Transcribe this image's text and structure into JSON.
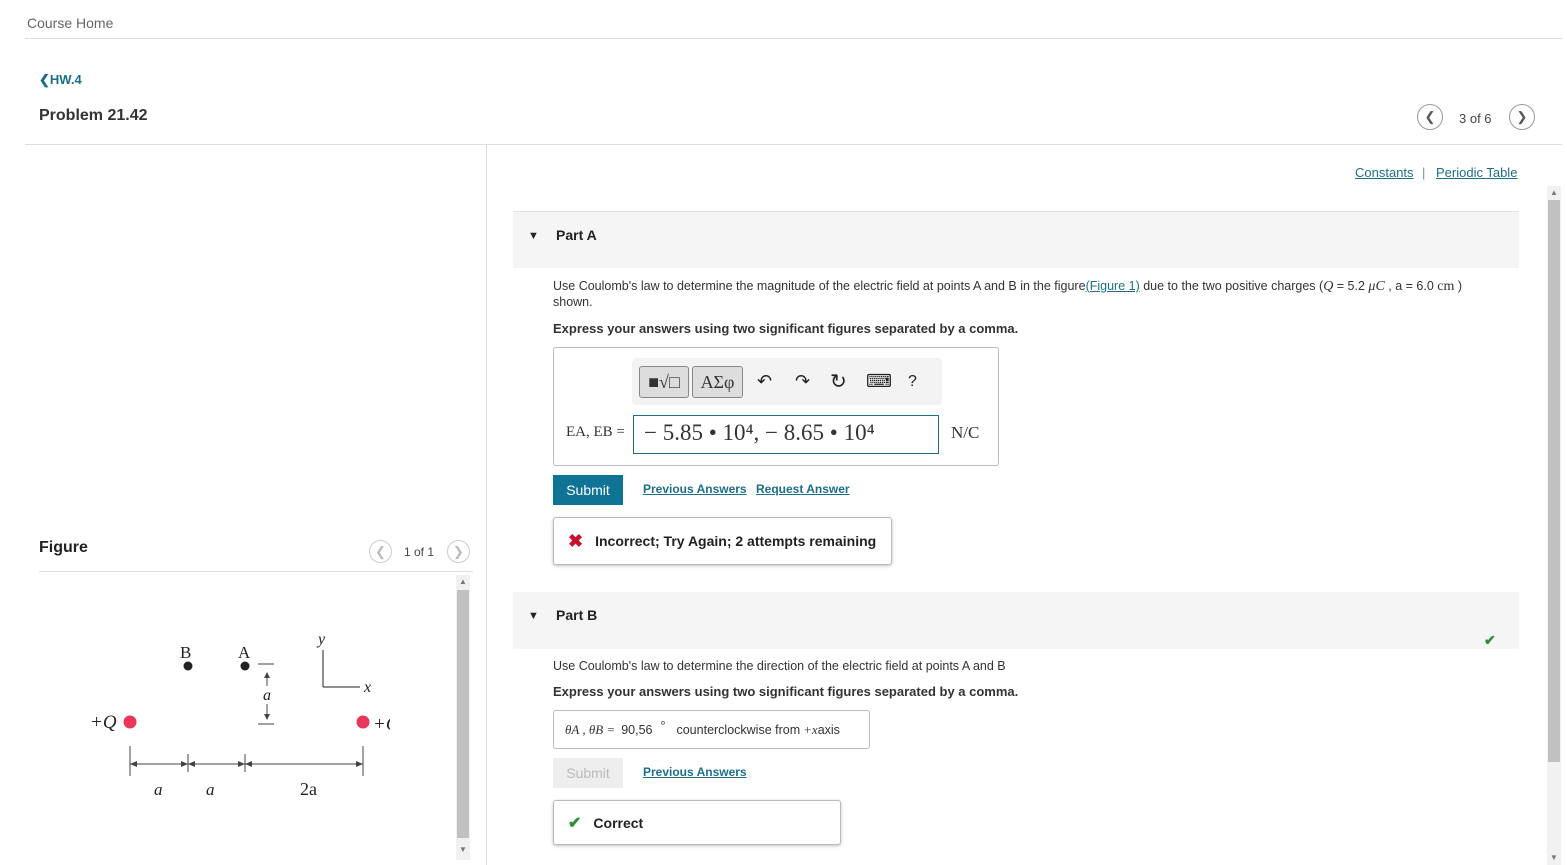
{
  "nav": {
    "course_home": "Course Home",
    "back_link": "HW.4",
    "problem_title": "Problem 21.42",
    "pager": "3 of 6"
  },
  "links": {
    "constants": "Constants",
    "separator": "|",
    "periodic_table": "Periodic Table"
  },
  "partA": {
    "label": "Part A",
    "question_pre": "Use Coulomb's law to determine the magnitude of the electric field at points A and B in the figure",
    "figure_link": "(Figure 1)",
    "question_post": " due to the two positive charges (",
    "q_sym": "Q",
    "q_val": " = 5.2 ",
    "q_unit": "μC",
    "a_text": " , a = 6.0 ",
    "a_unit": "cm",
    "close": " )",
    "question_line2": "shown.",
    "instruction": "Express your answers using two significant figures separated by a comma.",
    "toolbar": {
      "template_label": "■√□",
      "greek_label": "ΑΣφ",
      "undo": "↶",
      "redo": "↷",
      "reset": "↻",
      "keyboard": "⌨",
      "help": "?"
    },
    "answer_label": "EA, EB =",
    "answer_value": "− 5.85 • 10⁴, − 8.65 • 10⁴",
    "unit": "N/C",
    "submit": "Submit",
    "previous_answers": "Previous Answers",
    "request_answer": "Request Answer",
    "feedback": "Incorrect; Try Again; 2 attempts remaining",
    "feedback_icon": "✖"
  },
  "partB": {
    "label": "Part B",
    "check_icon": "✔",
    "question": "Use Coulomb's law to determine the direction of the electric field at points A and B",
    "instruction": "Express your answers using two significant figures separated by a comma.",
    "answer_label": "θA , θB =",
    "answer_value": "90,56",
    "degree": "°",
    "direction_pre": "counterclockwise from ",
    "direction_axis": "+x",
    "direction_post": " axis",
    "submit": "Submit",
    "previous_answers": "Previous Answers",
    "feedback": "Correct",
    "feedback_icon": "✔"
  },
  "figure": {
    "title": "Figure",
    "pager": "1 of 1",
    "labels": {
      "B": "B",
      "A": "A",
      "y": "y",
      "x": "x",
      "a_vertical": "a",
      "plusQ_left": "+Q",
      "plusQ_right": "+Q",
      "dim_a1": "a",
      "dim_a2": "a",
      "dim_2a": "2a"
    },
    "colors": {
      "charge": "#e8375a",
      "point": "#222222"
    }
  },
  "colors": {
    "accent": "#1c6f88",
    "submit_bg": "#0f7396",
    "incorrect": "#c8102e",
    "correct": "#2f8a3a"
  }
}
